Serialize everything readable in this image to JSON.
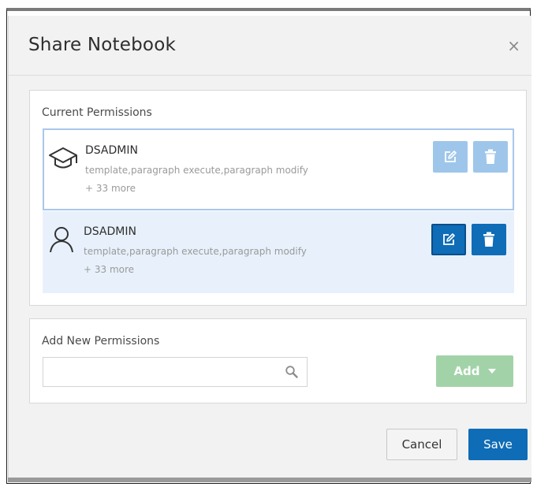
{
  "dialog": {
    "title": "Share Notebook",
    "close_label": "×"
  },
  "current_permissions": {
    "label": "Current Permissions",
    "items": [
      {
        "name": "DSADMIN",
        "icon": "graduation-cap-icon",
        "permissions": "template,paragraph execute,paragraph modify",
        "more": "+ 33 more"
      },
      {
        "name": "DSADMIN",
        "icon": "user-icon",
        "permissions": "template,paragraph execute,paragraph modify",
        "more": "+ 33 more"
      }
    ]
  },
  "add_permissions": {
    "label": "Add New Permissions",
    "search_value": "",
    "search_placeholder": "",
    "add_label": "Add"
  },
  "footer": {
    "cancel_label": "Cancel",
    "save_label": "Save"
  },
  "colors": {
    "primary": "#0f6cb6",
    "primary_light": "#9ec6ea",
    "add_green": "#a2d3a8",
    "selected_row_bg": "#e8f1fb"
  }
}
